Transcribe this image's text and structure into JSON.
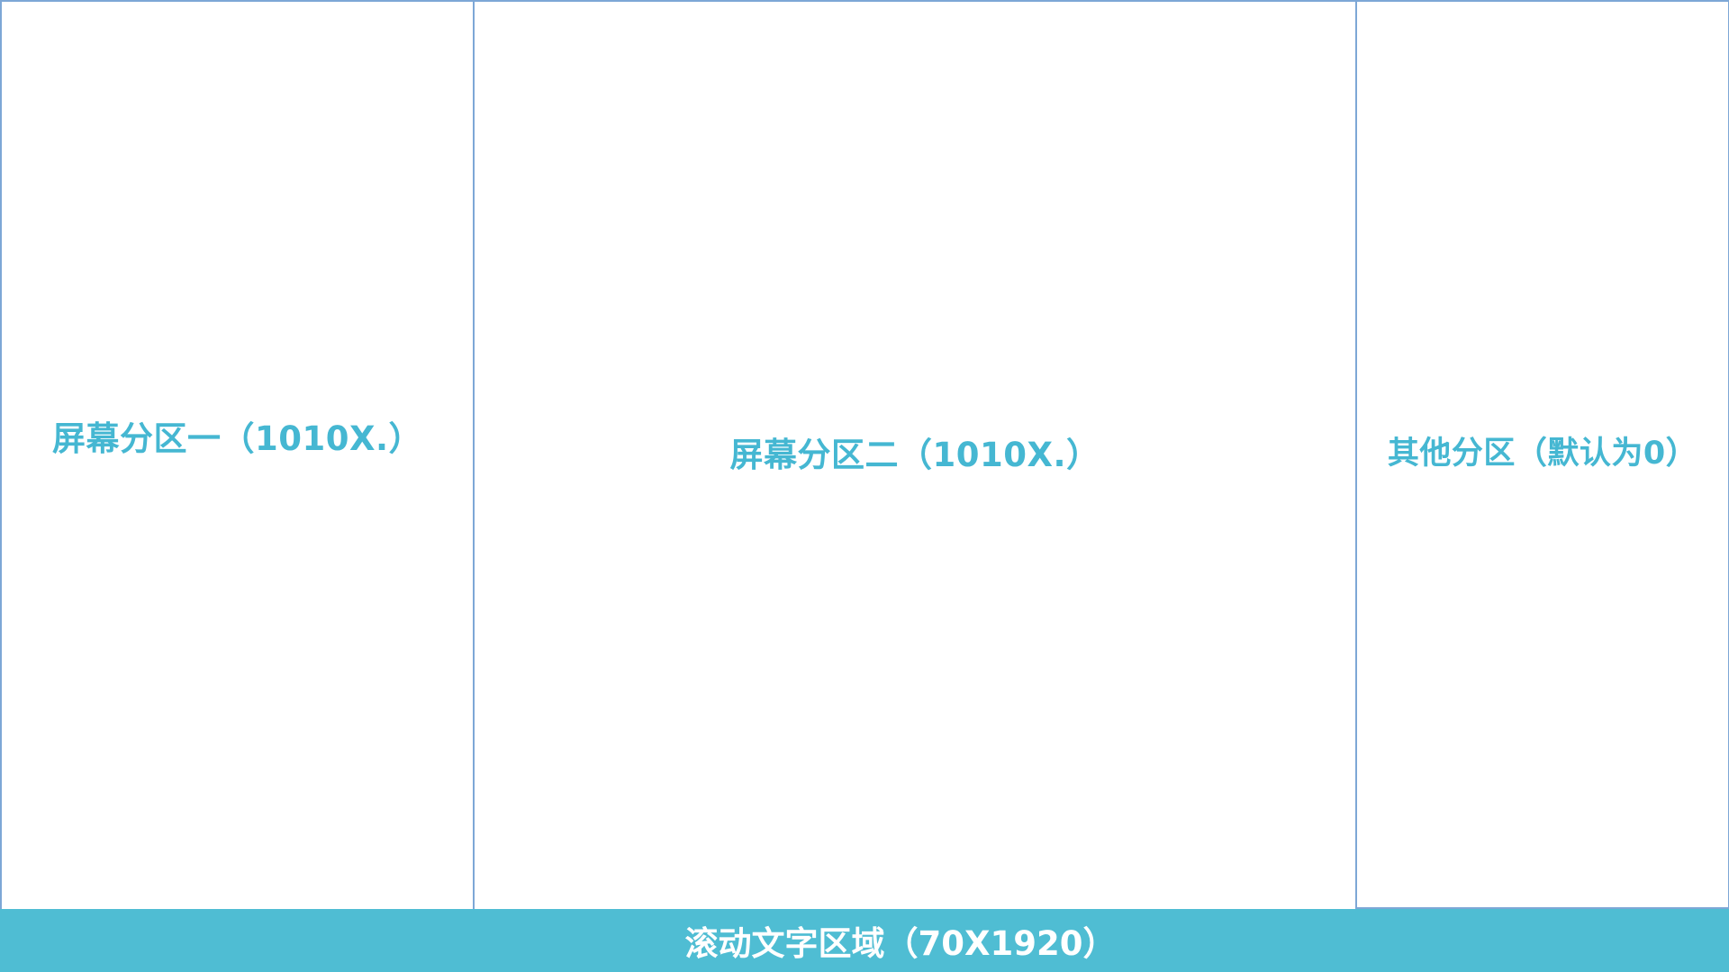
{
  "partitions": {
    "one": {
      "label": "屏幕分区一（1010X.）"
    },
    "two": {
      "label": "屏幕分区二（1010X.）"
    },
    "other": {
      "label": "其他分区（默认为0）"
    }
  },
  "ticker": {
    "label": "滚动文字区域（70X1920）"
  },
  "colors": {
    "label_text": "#45b7d2",
    "border": "#7da7d6",
    "ticker_background": "#4fbdd3",
    "ticker_text": "#ffffff"
  }
}
